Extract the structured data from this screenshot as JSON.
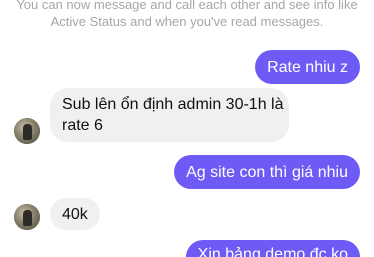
{
  "notice": {
    "line1": "You can now message and call each other and see info like",
    "line2": "Active Status and when you've read messages."
  },
  "messages": [
    {
      "direction": "outgoing",
      "text": "Rate nhiu z"
    },
    {
      "direction": "incoming",
      "line1": "Sub lên ổn định admin 30-1h là",
      "line2": "rate 6"
    },
    {
      "direction": "outgoing",
      "text": "Ag site con thì giá nhiu"
    },
    {
      "direction": "incoming",
      "text": "40k"
    },
    {
      "direction": "outgoing",
      "text": "Xin bảng demo đc ko"
    }
  ],
  "colors": {
    "outgoing_bubble": "#6e5bf5",
    "incoming_bubble": "#f0f0f2",
    "notice_text": "#a6a6ab"
  },
  "icons": {
    "avatar": "contact-avatar"
  }
}
